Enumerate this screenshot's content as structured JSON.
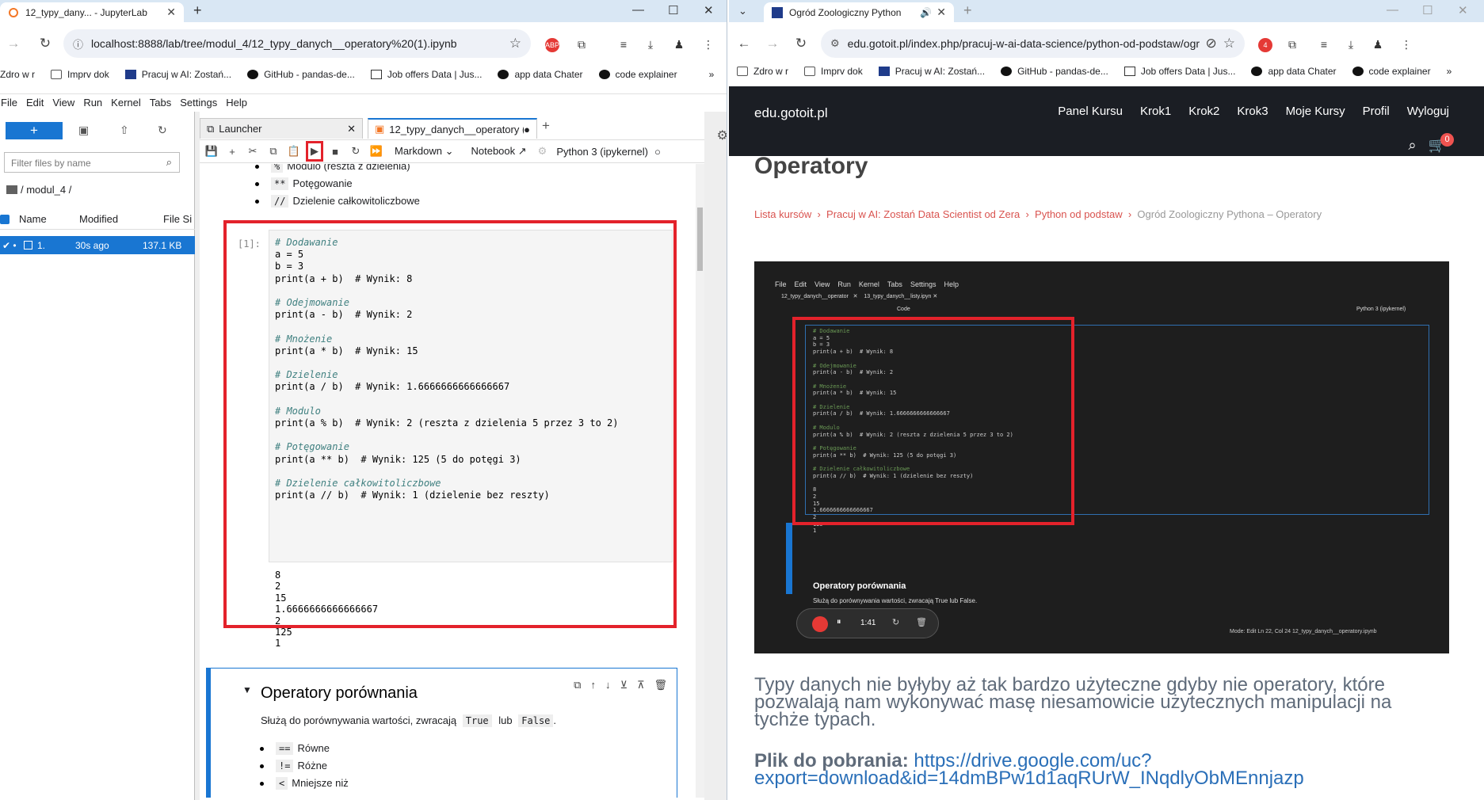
{
  "left_window": {
    "tab_title": "12_typy_dany... - JupyterLab",
    "url": "localhost:8888/lab/tree/modul_4/12_typy_danych__operatory%20(1).ipynb",
    "bookmarks": [
      "Zdro w r",
      "Imprv dok",
      "Pracuj w AI: Zostań...",
      "GitHub - pandas-de...",
      "Job offers Data | Jus...",
      "app data Chater",
      "code explainer"
    ],
    "bookmarks_more": "»"
  },
  "jupyter": {
    "menu": [
      "File",
      "Edit",
      "View",
      "Run",
      "Kernel",
      "Tabs",
      "Settings",
      "Help"
    ],
    "filter_placeholder": "Filter files by name",
    "breadcrumb": "/ modul_4 /",
    "columns": {
      "name": "Name",
      "modified": "Modified",
      "size": "File Si"
    },
    "file": {
      "name": "1.",
      "modified": "30s ago",
      "size": "137.1 KB"
    },
    "tabs": {
      "launcher": "Launcher",
      "notebook": "12_typy_danych__operatory ("
    },
    "toolbar": {
      "cell_type": "Markdown",
      "notebook_btn": "Notebook",
      "kernel": "Python 3 (ipykernel)"
    },
    "md_list_top": [
      {
        "code": "%",
        "text": "Modulo (reszta z dzielenia)"
      },
      {
        "code": "**",
        "text": "Potęgowanie"
      },
      {
        "code": "//",
        "text": "Dzielenie całkowitoliczbowe"
      }
    ],
    "cell_prompt": "[1]:",
    "code_lines": [
      {
        "t": "# Dodawanie",
        "k": "cm"
      },
      {
        "t": "a = 5",
        "k": "code"
      },
      {
        "t": "b = 3",
        "k": "code"
      },
      {
        "t": "print(a + b)  # Wynik: 8",
        "k": "code"
      },
      {
        "t": "",
        "k": "blank"
      },
      {
        "t": "# Odejmowanie",
        "k": "cm"
      },
      {
        "t": "print(a - b)  # Wynik: 2",
        "k": "code"
      },
      {
        "t": "",
        "k": "blank"
      },
      {
        "t": "# Mnożenie",
        "k": "cm"
      },
      {
        "t": "print(a * b)  # Wynik: 15",
        "k": "code"
      },
      {
        "t": "",
        "k": "blank"
      },
      {
        "t": "# Dzielenie",
        "k": "cm"
      },
      {
        "t": "print(a / b)  # Wynik: 1.6666666666666667",
        "k": "code"
      },
      {
        "t": "",
        "k": "blank"
      },
      {
        "t": "# Modulo",
        "k": "cm"
      },
      {
        "t": "print(a % b)  # Wynik: 2 (reszta z dzielenia 5 przez 3 to 2)",
        "k": "code"
      },
      {
        "t": "",
        "k": "blank"
      },
      {
        "t": "# Potęgowanie",
        "k": "cm"
      },
      {
        "t": "print(a ** b)  # Wynik: 125 (5 do potęgi 3)",
        "k": "code"
      },
      {
        "t": "",
        "k": "blank"
      },
      {
        "t": "# Dzielenie całkowitoliczbowe",
        "k": "cm"
      },
      {
        "t": "print(a // b)  # Wynik: 1 (dzielenie bez reszty)",
        "k": "code"
      }
    ],
    "outputs": [
      "8",
      "2",
      "15",
      "1.6666666666666667",
      "2",
      "125",
      "1"
    ],
    "md_cell": {
      "heading": "Operatory porównania",
      "text_before": "Służą do porównywania wartości, zwracają",
      "code_true": "True",
      "text_mid": "lub",
      "code_false": "False",
      "text_after": ".",
      "items": [
        {
          "code": "==",
          "text": "Równe"
        },
        {
          "code": "!=",
          "text": "Różne"
        },
        {
          "code": "<",
          "text": "Mniejsze niż"
        }
      ]
    }
  },
  "right_window": {
    "tab_title": "Ogród Zoologiczny Python",
    "url": "edu.gotoit.pl/index.php/pracuj-w-ai-data-science/python-od-podstaw/ogr...",
    "bookmarks": [
      "Zdro w r",
      "Imprv dok",
      "Pracuj w AI: Zostań...",
      "GitHub - pandas-de...",
      "Job offers Data | Jus...",
      "app data Chater",
      "code explainer"
    ],
    "ext_badge": "4"
  },
  "site": {
    "logo": "edu.gotoit.pl",
    "nav": [
      "Panel Kursu",
      "Krok1",
      "Krok2",
      "Krok3",
      "Moje Kursy",
      "Profil",
      "Wyloguj"
    ],
    "cart_count": "0",
    "page_title": "Operatory",
    "breadcrumbs": [
      "Lista kursów",
      "Pracuj w AI: Zostań Data Scientist od Zera",
      "Python od podstaw",
      "Ogród Zoologiczny Pythona – Operatory"
    ],
    "video": {
      "menu": [
        "File",
        "Edit",
        "View",
        "Run",
        "Kernel",
        "Tabs",
        "Settings",
        "Help"
      ],
      "tab1": "12_typy_danych__operator",
      "tab2": "13_typy_danych__listy.ipyn",
      "celltype": "Code",
      "kernel": "Python 3 (ipykernel)",
      "heading": "Operatory porównania",
      "sub": "Służą do porównywania wartości, zwracają True lub False.",
      "time": "1:41",
      "status": "Mode: Edit   Ln 22, Col 24   12_typy_danych__operatory.ipynb"
    },
    "article": "Typy danych nie byłyby aż tak bardzo użyteczne gdyby nie operatory, które pozwalają nam wykonywać masę niesamowicie użytecznych manipulacji na tychże typach.",
    "download_label": "Plik do pobrania:",
    "download_url": "https://drive.google.com/uc?export=download&id=14dmBPw1d1aqRUrW_INqdlyObMEnnjazp"
  },
  "colors": {
    "highlight": "#e3222b",
    "jupyter_blue": "#1976d2",
    "site_header": "#1b1e24"
  }
}
